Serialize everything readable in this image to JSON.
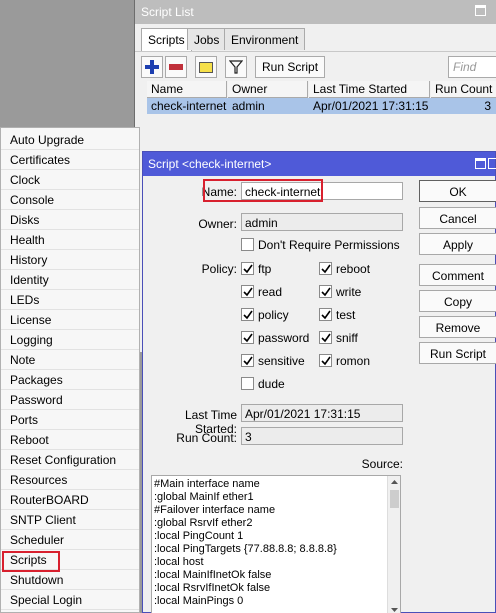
{
  "script_list": {
    "title": "Script List",
    "tabs": [
      "Scripts",
      "Jobs",
      "Environment"
    ],
    "run_script_label": "Run Script",
    "find_placeholder": "Find",
    "columns": [
      "Name",
      "Owner",
      "Last Time Started",
      "Run Count"
    ],
    "rows": [
      {
        "name": "check-internet",
        "owner": "admin",
        "last_started": "Apr/01/2021 17:31:15",
        "run_count": "3"
      }
    ]
  },
  "system_menu": {
    "items": [
      "Auto Upgrade",
      "Certificates",
      "Clock",
      "Console",
      "Disks",
      "Health",
      "History",
      "Identity",
      "LEDs",
      "License",
      "Logging",
      "Note",
      "Packages",
      "Password",
      "Ports",
      "Reboot",
      "Reset Configuration",
      "Resources",
      "RouterBOARD",
      "SNTP Client",
      "Scheduler",
      "Scripts",
      "Shutdown",
      "Special Login"
    ],
    "highlighted": "Scripts"
  },
  "dialog": {
    "title": "Script <check-internet>",
    "name_label": "Name:",
    "name_value": "check-internet",
    "owner_label": "Owner:",
    "owner_value": "admin",
    "dont_require_label": "Don't Require Permissions",
    "policy_label": "Policy:",
    "policies": [
      {
        "label": "ftp",
        "checked": true
      },
      {
        "label": "reboot",
        "checked": true
      },
      {
        "label": "read",
        "checked": true
      },
      {
        "label": "write",
        "checked": true
      },
      {
        "label": "policy",
        "checked": true
      },
      {
        "label": "test",
        "checked": true
      },
      {
        "label": "password",
        "checked": true
      },
      {
        "label": "sniff",
        "checked": true
      },
      {
        "label": "sensitive",
        "checked": true
      },
      {
        "label": "romon",
        "checked": true
      },
      {
        "label": "dude",
        "checked": false
      }
    ],
    "last_started_label": "Last Time Started:",
    "last_started_value": "Apr/01/2021 17:31:15",
    "run_count_label": "Run Count:",
    "run_count_value": "3",
    "source_label": "Source:",
    "source_lines": [
      "#Main interface name",
      ":global MainIf ether1",
      "#Failover interface name",
      ":global RsrvIf ether2",
      ":local PingCount 1",
      ":local PingTargets {77.88.8.8; 8.8.8.8}",
      ":local host",
      ":local MainIfInetOk false",
      ":local RsrvIfInetOk false",
      ":local MainPings 0"
    ],
    "buttons": [
      "OK",
      "Cancel",
      "Apply",
      "Comment",
      "Copy",
      "Remove",
      "Run Script"
    ]
  },
  "colors": {
    "dialog_title_bg": "#4f5ad8",
    "highlight_border": "#d8202e",
    "selected_row": "#a9c4e8"
  }
}
